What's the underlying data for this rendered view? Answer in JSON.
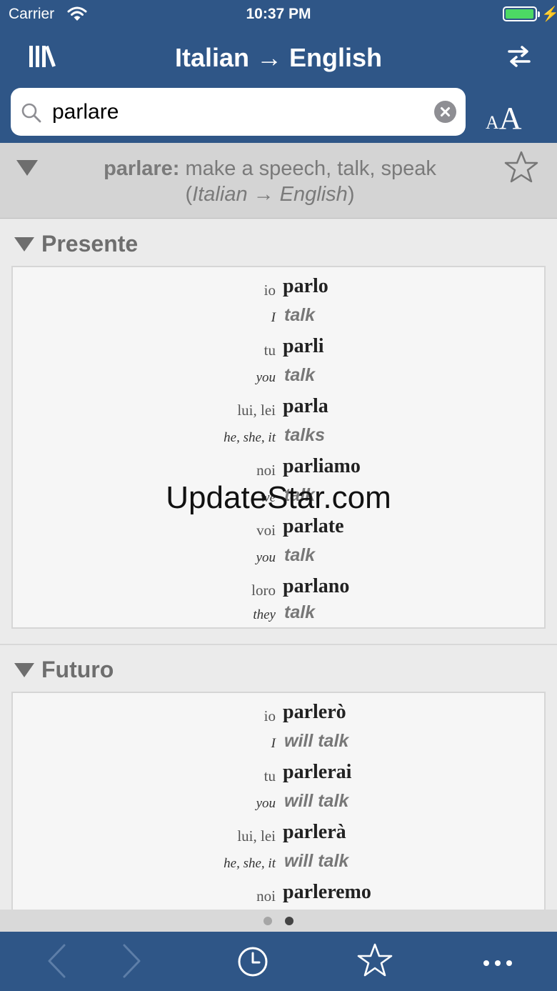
{
  "status_bar": {
    "carrier": "Carrier",
    "time": "10:37 PM"
  },
  "nav": {
    "title": "Italian → English"
  },
  "search": {
    "query": "parlare"
  },
  "font_size_label": {
    "small": "A",
    "big": "A"
  },
  "entry": {
    "headword": "parlare:",
    "meaning": " make a speech, talk, speak",
    "direction_open": "(",
    "direction": "Italian → English",
    "direction_close": ")"
  },
  "sections": [
    {
      "name": "Presente",
      "rows": [
        {
          "pronoun": "io",
          "form": "parlo",
          "pronoun_en": "I",
          "translation": "talk"
        },
        {
          "pronoun": "tu",
          "form": "parli",
          "pronoun_en": "you",
          "translation": "talk"
        },
        {
          "pronoun": "lui, lei",
          "form": "parla",
          "pronoun_en": "he, she, it",
          "translation": "talks"
        },
        {
          "pronoun": "noi",
          "form": "parliamo",
          "pronoun_en": "we",
          "translation": "talk"
        },
        {
          "pronoun": "voi",
          "form": "parlate",
          "pronoun_en": "you",
          "translation": "talk"
        },
        {
          "pronoun": "loro",
          "form": "parlano",
          "pronoun_en": "they",
          "translation": "talk"
        }
      ]
    },
    {
      "name": "Futuro",
      "rows": [
        {
          "pronoun": "io",
          "form": "parlerò",
          "pronoun_en": "I",
          "translation": "will talk"
        },
        {
          "pronoun": "tu",
          "form": "parlerai",
          "pronoun_en": "you",
          "translation": "will talk"
        },
        {
          "pronoun": "lui, lei",
          "form": "parlerà",
          "pronoun_en": "he, she, it",
          "translation": "will talk"
        },
        {
          "pronoun": "noi",
          "form": "parleremo"
        }
      ]
    }
  ],
  "watermark": "UpdateStar.com",
  "page_indicator": {
    "count": 2,
    "active": 1
  },
  "colors": {
    "bar_bg": "#2f5687",
    "battery": "#4cd964",
    "inactive_icon": "#5d7ea8"
  },
  "toolbar_icons": [
    "back-icon",
    "forward-icon",
    "history-icon",
    "favorites-icon",
    "more-icon"
  ]
}
